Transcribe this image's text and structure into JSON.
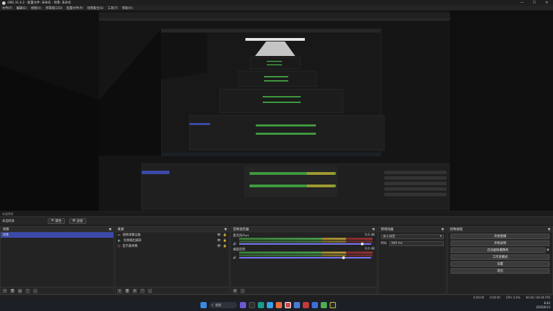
{
  "window": {
    "title": "OBS 31.0.2 - 配置文件: 未命名 - 场景: 未命名",
    "controls": [
      "—",
      "☐",
      "✕"
    ]
  },
  "menu": [
    "文件(F)",
    "编辑(E)",
    "视图(V)",
    "停靠窗口(D)",
    "配置文件(P)",
    "场景集合(S)",
    "工具(T)",
    "帮助(H)"
  ],
  "context": {
    "label": "未选择源"
  },
  "toolbar": {
    "label": "未选择源",
    "properties": "属性",
    "filters": "滤镜"
  },
  "docks": {
    "scenes": {
      "title": "场景",
      "items": [
        "场景"
      ]
    },
    "sources": {
      "title": "来源",
      "items": [
        "视频采集设备",
        "音频输出捕获",
        "显示器采集"
      ]
    },
    "mixer": {
      "title": "音频混音器",
      "tracks": [
        {
          "name": "麦克风/Aux",
          "db": "0.0 dB",
          "level": 0.92
        },
        {
          "name": "桌面音频",
          "db": "0.0 dB",
          "level": 0.78
        }
      ]
    },
    "transitions": {
      "title": "转场动画",
      "type": "淡入淡出",
      "duration_label": "时长",
      "duration": "300 ms"
    },
    "controls": {
      "title": "控制按钮",
      "buttons": [
        "开始直播",
        "开始录制",
        "启动虚拟摄像机",
        "工作室模式",
        "设置",
        "退出"
      ]
    }
  },
  "status": {
    "network": "0:00:00",
    "rec": "0:00:00",
    "cpu": "CPU: 0.6%",
    "fps": "60.00 / 60.00 FPS"
  },
  "taskbar": {
    "search": "搜索",
    "time": "8:42",
    "date": "2025/6/13"
  },
  "colors": {
    "accent": "#3b4aa8",
    "bg": "#1e1e1e",
    "panel": "#232323"
  }
}
